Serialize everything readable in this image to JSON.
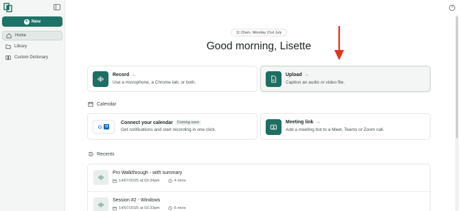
{
  "sidebar": {
    "new_label": "New",
    "items": [
      {
        "label": "Home",
        "icon": "home-icon",
        "active": true
      },
      {
        "label": "Library",
        "icon": "folder-icon",
        "active": false
      },
      {
        "label": "Custom Dictionary",
        "icon": "book-icon",
        "active": false
      }
    ]
  },
  "header": {
    "datetime": "11:20am, Monday 21st July",
    "greeting": "Good morning, Lisette"
  },
  "actions": {
    "record": {
      "title": "Record",
      "arrow": "→",
      "subtitle": "Use a microphone, a Chrome tab, or both."
    },
    "upload": {
      "title": "Upload",
      "arrow": "→",
      "subtitle": "Caption an audio or video file."
    }
  },
  "calendar": {
    "section_label": "Calendar",
    "connect": {
      "title": "Connect your calendar",
      "badge": "Coming soon",
      "subtitle": "Get notifications and start recording in one click.",
      "google_letter": "G",
      "outlook_letter": "O"
    },
    "meeting": {
      "title": "Meeting link",
      "arrow": "→",
      "subtitle": "Add a meeting bot to a Meet, Teams or Zoom call."
    }
  },
  "recents": {
    "section_label": "Recents",
    "items": [
      {
        "title": "Pro Walkthrough - with summary",
        "date": "14/07/2025 at 03:34pm",
        "duration": "4 mins"
      },
      {
        "title": "Session #2 - Windows",
        "date": "14/07/2025 at 03:33pm",
        "duration": "6 mins"
      }
    ]
  },
  "colors": {
    "brand": "#1e7466",
    "annotation": "#e8321e"
  },
  "help_symbol": "?"
}
